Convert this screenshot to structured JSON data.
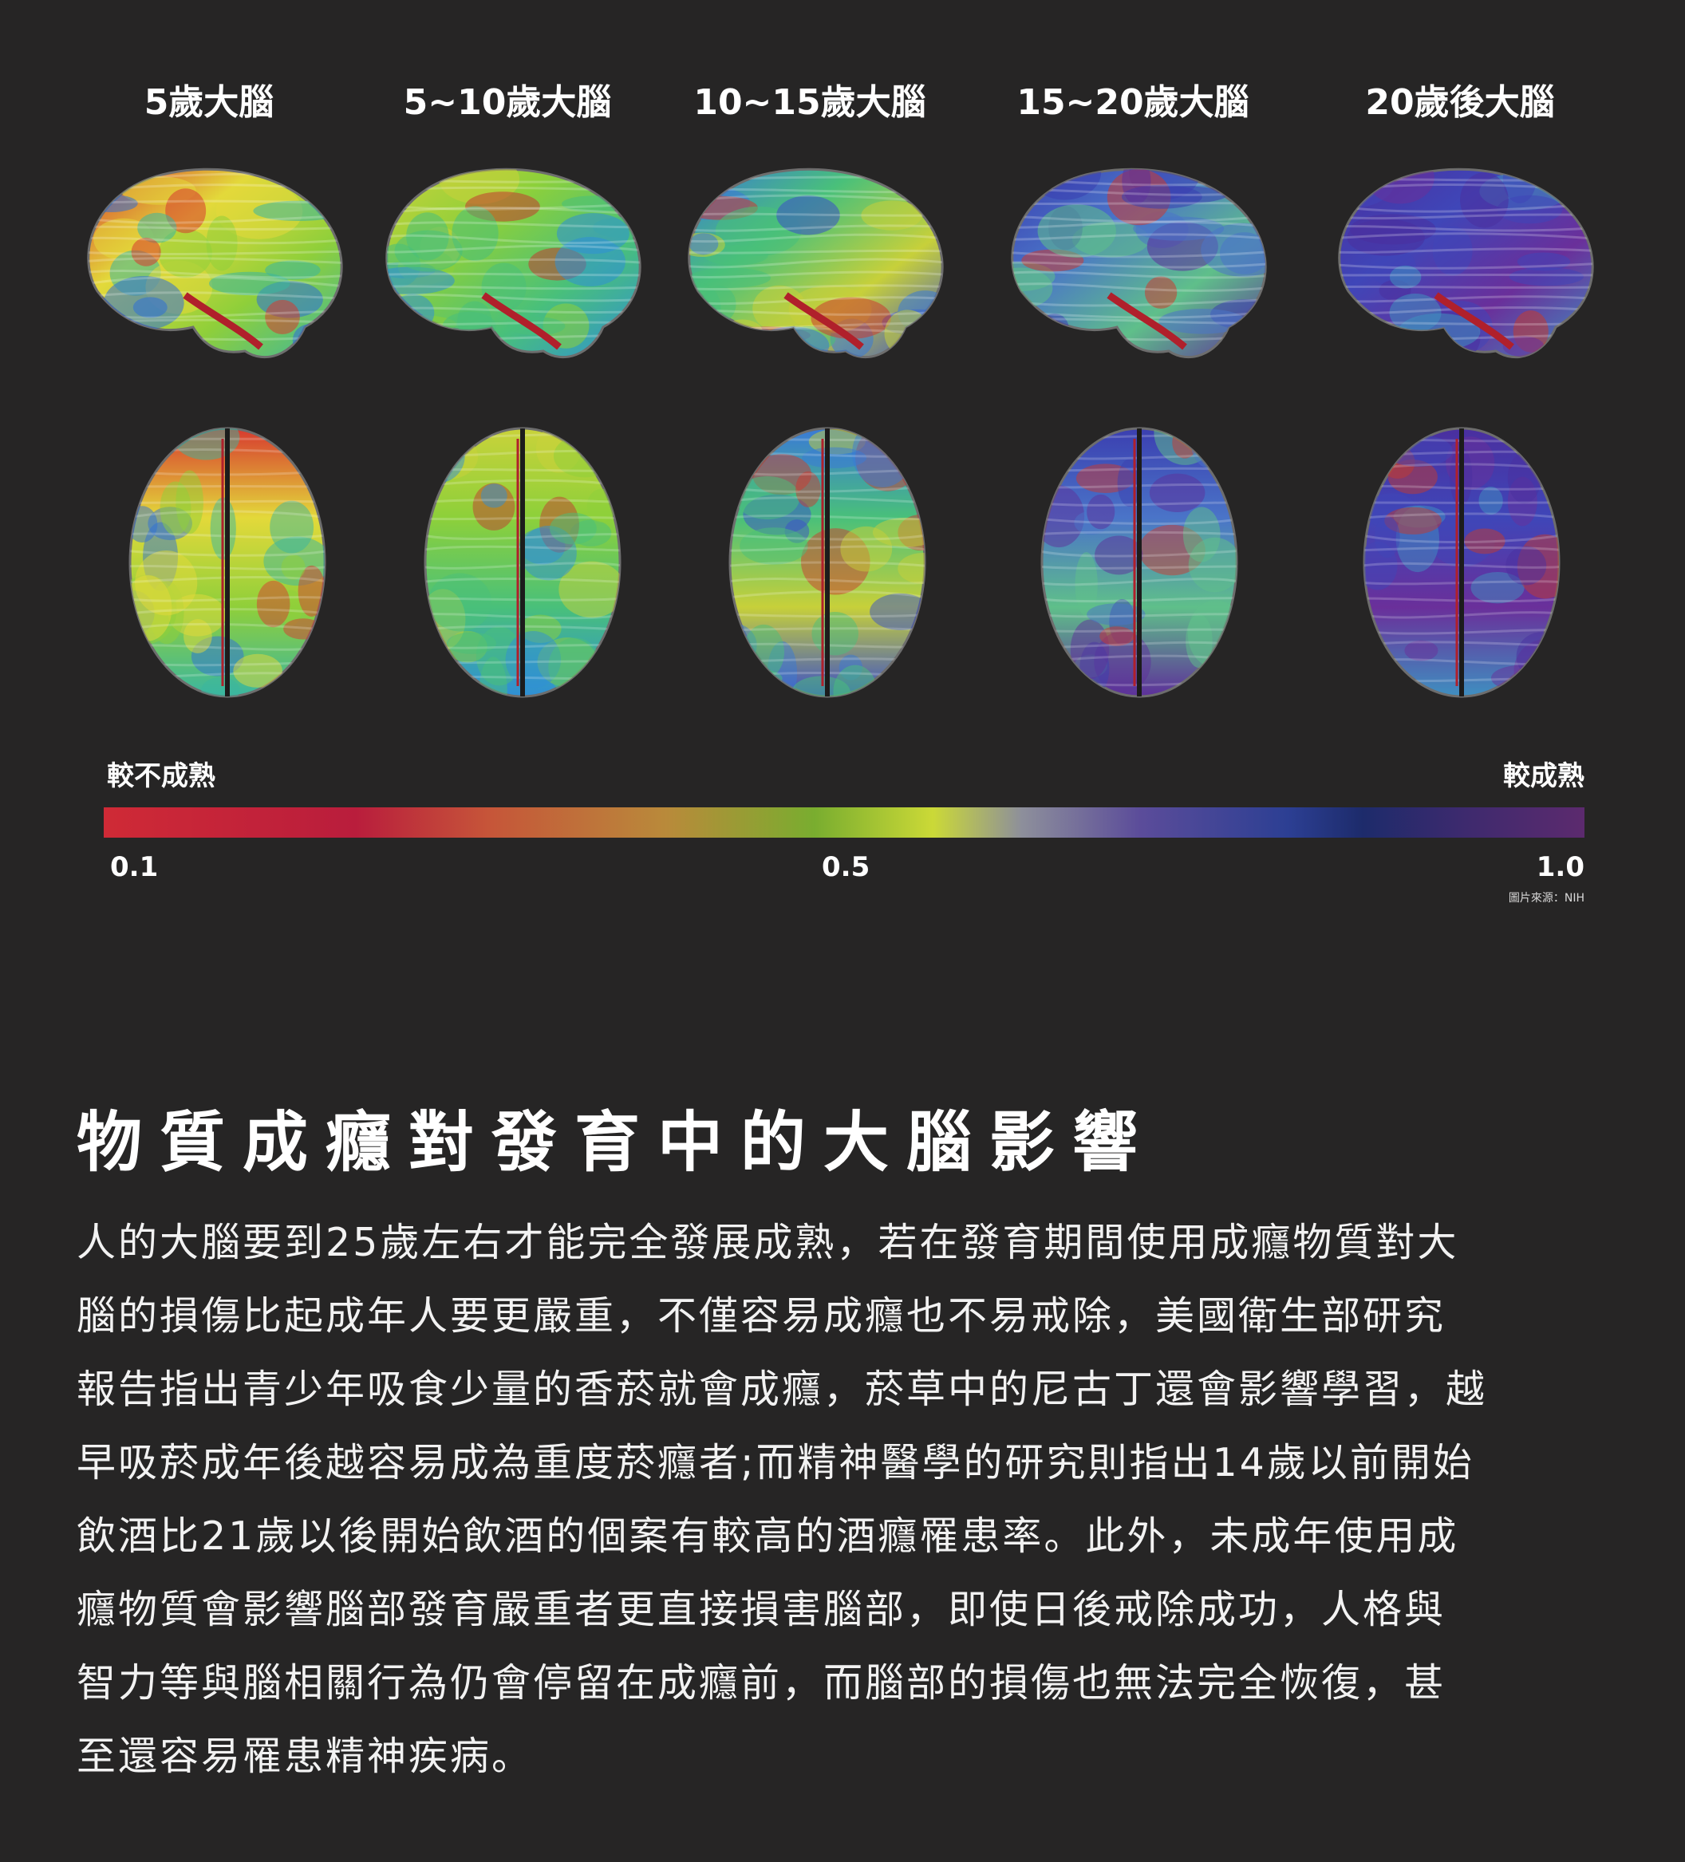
{
  "stages": [
    {
      "label": "5歲大腦",
      "maturity": 0.15
    },
    {
      "label": "5~10歲大腦",
      "maturity": 0.35
    },
    {
      "label": "10~15歲大腦",
      "maturity": 0.55
    },
    {
      "label": "15~20歲大腦",
      "maturity": 0.78
    },
    {
      "label": "20歲後大腦",
      "maturity": 0.93
    }
  ],
  "scale": {
    "left_label": "較不成熟",
    "right_label": "較成熟",
    "ticks": [
      "0.1",
      "0.5",
      "1.0"
    ],
    "credit": "圖片來源：NIH"
  },
  "colors": {
    "immature": "#cf2a36",
    "mid": "#cbd937",
    "mature": "#5c2a6e"
  },
  "article": {
    "title": "物質成癮對發育中的大腦影響",
    "lines": [
      "人的大腦要到25歲左右才能完全發展成熟，若在發育期間使用成癮物質對大",
      "腦的損傷比起成年人要更嚴重，不僅容易成癮也不易戒除，美國衛生部研究",
      "報告指出青少年吸食少量的香菸就會成癮，菸草中的尼古丁還會影響學習，越",
      "早吸菸成年後越容易成為重度菸癮者;而精神醫學的研究則指出14歲以前開始",
      "飲酒比21歲以後開始飲酒的個案有較高的酒癮罹患率。此外，未成年使用成",
      "癮物質會影響腦部發育嚴重者更直接損害腦部，即使日後戒除成功，人格與",
      "智力等與腦相關行為仍會停留在成癮前，而腦部的損傷也無法完全恢復，甚",
      "至還容易罹患精神疾病。"
    ]
  }
}
